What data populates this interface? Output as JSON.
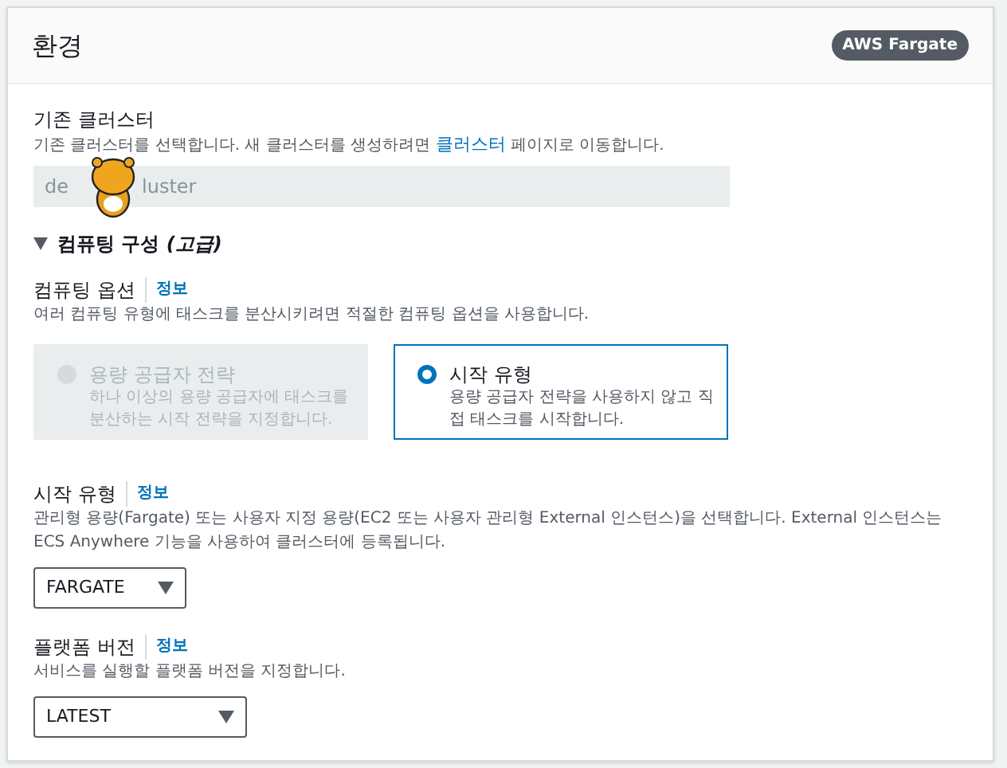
{
  "panel": {
    "title": "환경",
    "badge": "AWS Fargate"
  },
  "cluster": {
    "label": "기존 클러스터",
    "description_before": "기존 클러스터를 선택합니다. 새 클러스터를 생성하려면",
    "link": "클러스터",
    "description_after": "페이지로 이동합니다.",
    "value_start": "de",
    "value_end": "luster"
  },
  "section": {
    "label": "컴퓨팅 구성 ",
    "label_italic": "(고급)",
    "expanded": true
  },
  "compute_options": {
    "label": "컴퓨팅 옵션",
    "info": "정보",
    "description": "여러 컴퓨팅 유형에 태스크를 분산시키려면 적절한 컴퓨팅 옵션을 사용합니다.",
    "options": [
      {
        "title": "용량 공급자 전략",
        "description": "하나 이상의 용량 공급자에 태스크를 분산하는 시작 전략을 지정합니다.",
        "selected": false,
        "disabled": true
      },
      {
        "title": "시작 유형",
        "description": "용량 공급자 전략을 사용하지 않고 직접 태스크를 시작합니다.",
        "selected": true,
        "disabled": false
      }
    ]
  },
  "launch_type": {
    "label": "시작 유형",
    "info": "정보",
    "description": "관리형 용량(Fargate) 또는 사용자 지정 용량(EC2 또는 사용자 관리형 External 인스턴스)을 선택합니다. External 인스턴스는 ECS Anywhere 기능을 사용하여 클러스터에 등록됩니다.",
    "value": "FARGATE"
  },
  "platform_version": {
    "label": "플랫폼 버전",
    "info": "정보",
    "description": "서비스를 실행할 플랫폼 버전을 지정합니다.",
    "value": "LATEST"
  }
}
